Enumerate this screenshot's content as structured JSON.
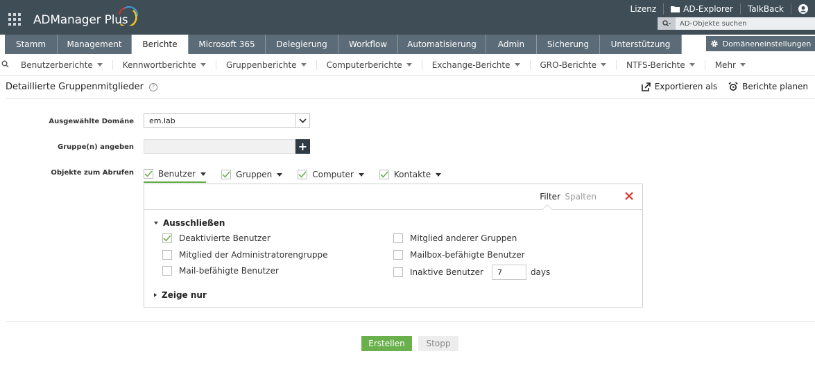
{
  "app": {
    "name": "ADManager Plus"
  },
  "top_links": {
    "lizenz": "Lizenz",
    "ad_explorer": "AD-Explorer",
    "talkback": "TalkBack"
  },
  "search": {
    "placeholder": "AD-Objekte suchen"
  },
  "nav": {
    "tabs": [
      "Stamm",
      "Management",
      "Berichte",
      "Microsoft 365",
      "Delegierung",
      "Workflow",
      "Automatisierung",
      "Admin",
      "Sicherung",
      "Unterstützung"
    ],
    "active_tab": "Berichte",
    "domain_settings": "Domäneneinstellungen"
  },
  "subnav": {
    "items": [
      "Benutzerberichte",
      "Kennwortberichte",
      "Gruppenberichte",
      "Computerberichte",
      "Exchange-Berichte",
      "GRO-Berichte",
      "NTFS-Berichte",
      "Mehr"
    ]
  },
  "page": {
    "title": "Detaillierte Gruppenmitglieder",
    "export": "Exportieren als",
    "schedule": "Berichte planen"
  },
  "form": {
    "domain_label": "Ausgewählte Domäne",
    "domain_value": "em.lab",
    "group_label": "Gruppe(n) angeben",
    "objects_label": "Objekte zum Abrufen",
    "objects": [
      {
        "label": "Benutzer",
        "checked": true
      },
      {
        "label": "Gruppen",
        "checked": true
      },
      {
        "label": "Computer",
        "checked": true
      },
      {
        "label": "Kontakte",
        "checked": true
      }
    ]
  },
  "panel": {
    "filter_tab": "Filter",
    "columns_tab": "Spalten",
    "exclude_heading": "Ausschließen",
    "options": {
      "deactivated": {
        "label": "Deaktivierte Benutzer",
        "checked": true
      },
      "admin_group": {
        "label": "Mitglied der Administratorengruppe",
        "checked": false
      },
      "mail_enabled": {
        "label": "Mail-befähigte Benutzer",
        "checked": false
      },
      "other_groups": {
        "label": "Mitglied anderer Gruppen",
        "checked": false
      },
      "mailbox_enabled": {
        "label": "Mailbox-befähigte Benutzer",
        "checked": false
      },
      "inactive": {
        "label": "Inaktive Benutzer",
        "checked": false,
        "days_value": "7",
        "days_unit": "days"
      }
    },
    "show_only_heading": "Zeige nur"
  },
  "buttons": {
    "create": "Erstellen",
    "stop": "Stopp"
  },
  "colors": {
    "topbar": "#3f4d57",
    "tab": "#5b6b77",
    "accent_green": "#6ab04c",
    "close_red": "#d9302c"
  }
}
